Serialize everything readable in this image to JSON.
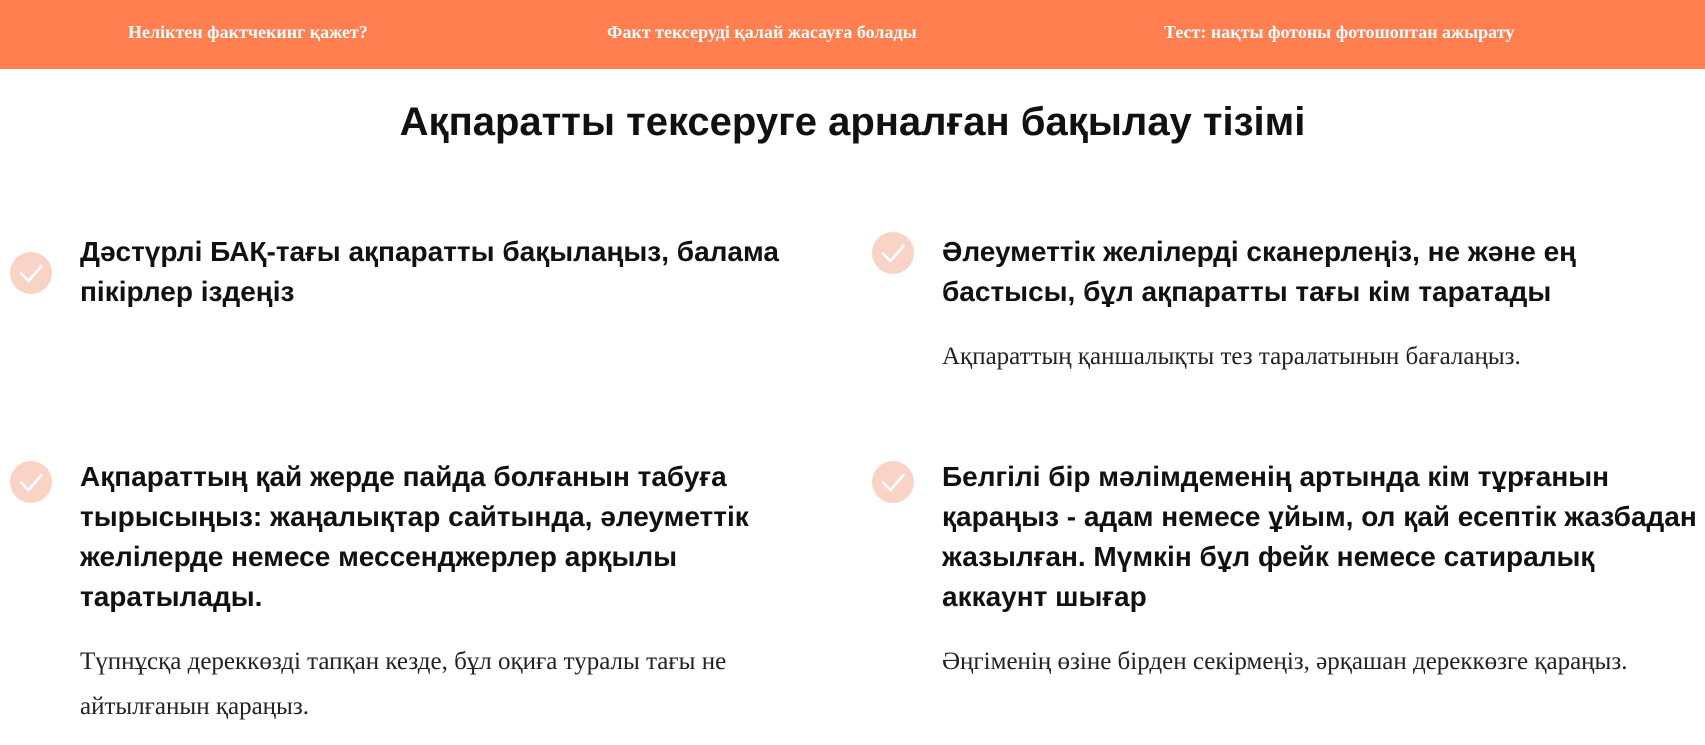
{
  "nav": {
    "items": [
      {
        "label": "Неліктен фактчекинг қажет?"
      },
      {
        "label": "Факт тексеруді қалай жасауға болады"
      },
      {
        "label": "Тест: нақты фотоны фотошоптан ажырату"
      }
    ]
  },
  "page_title": "Ақпаратты тексеруге арналған бақылау тізімі",
  "checklist": [
    {
      "icon": "check-icon",
      "title": "Дәстүрлі БАҚ-тағы ақпаратты бақылаңыз, балама пікірлер іздеңіз",
      "description": ""
    },
    {
      "icon": "check-icon",
      "title": "Әлеуметтік желілерді сканерлеңіз, не және ең бастысы, бұл ақпаратты тағы кім таратады",
      "description": "Ақпараттың қаншалықты тез таралатынын бағалаңыз."
    },
    {
      "icon": "check-icon",
      "title": "Ақпараттың қай жерде пайда болғанын табуға тырысыңыз: жаңалықтар сайтында, әлеуметтік желілерде немесе мессенджерлер арқылы таратылады.",
      "description": "Түпнұсқа дереккөзді тапқан кезде, бұл оқиға туралы тағы не айтылғанын қараңыз."
    },
    {
      "icon": "check-icon",
      "title": "Белгілі бір мәлімдеменің артында кім тұрғанын қараңыз - адам немесе ұйым, ол қай есептік жазбадан жазылған. Мүмкін бұл фейк немесе сатиралық аккаунт шығар",
      "description": "Әңгіменің өзіне бірден секірмеңіз, әрқашан дереккөзге қараңыз."
    }
  ],
  "colors": {
    "topbar": "#ff7f50",
    "check_circle": "#f9d3c6"
  }
}
